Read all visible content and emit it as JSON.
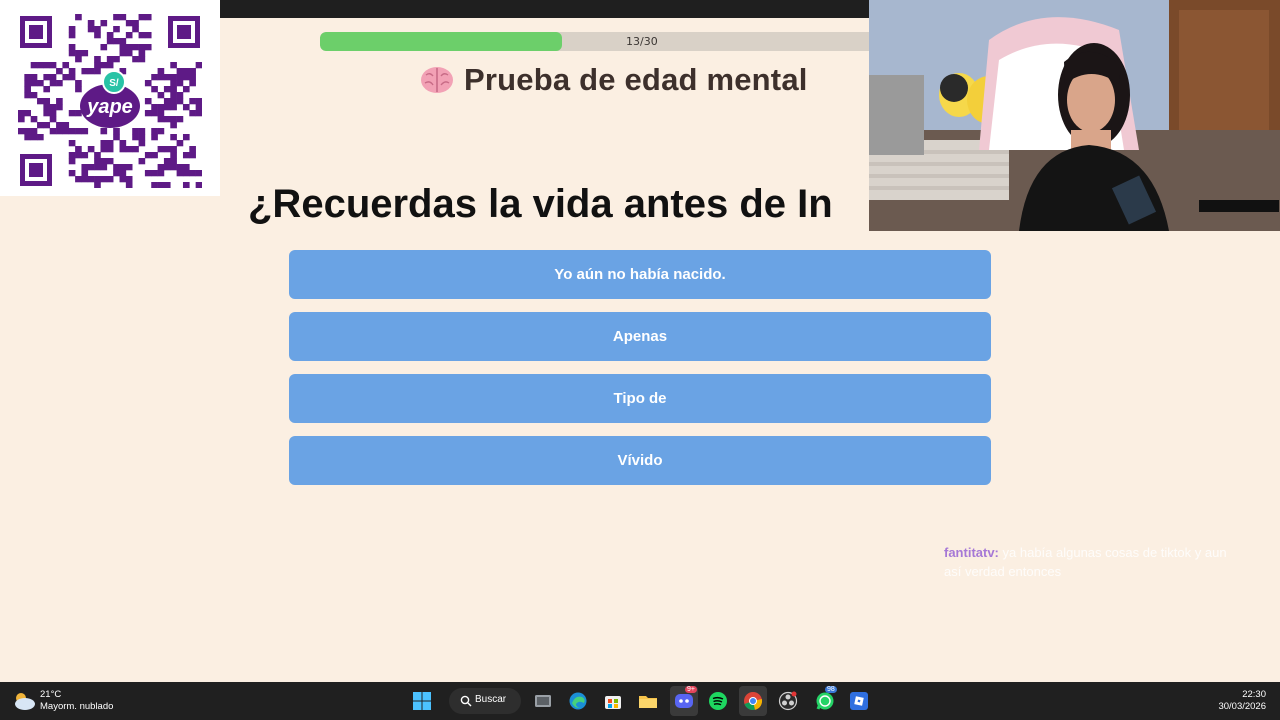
{
  "donation": {
    "brand": "yape",
    "currency_badge": "S/"
  },
  "quiz": {
    "progress": {
      "current": 13,
      "total": 30,
      "fraction": 0.433,
      "label": "13/30"
    },
    "title": "Prueba de edad mental",
    "title_icon": "brain-icon",
    "question": "¿Recuerdas la vida antes de In",
    "answers": [
      "Yo aún no había nacido.",
      "Apenas",
      "Tipo de",
      "Vívido"
    ]
  },
  "chat": {
    "username": "fantitatv:",
    "message": "ya había algunas cosas de tiktok y aun así verdad entonces"
  },
  "taskbar": {
    "weather": {
      "temp": "21°C",
      "condition": "Mayorm. nublado"
    },
    "search_label": "Buscar",
    "discord_badge": "9+",
    "whatsapp_badge": "98",
    "time": "22:30",
    "date": "30/03/2026"
  },
  "colors": {
    "page_bg": "#fbefe2",
    "progress_fill": "#6ccf6a",
    "answer_bg": "#6aa3e4",
    "chat_username": "#a678d6",
    "yape_purple": "#5e1a86"
  }
}
